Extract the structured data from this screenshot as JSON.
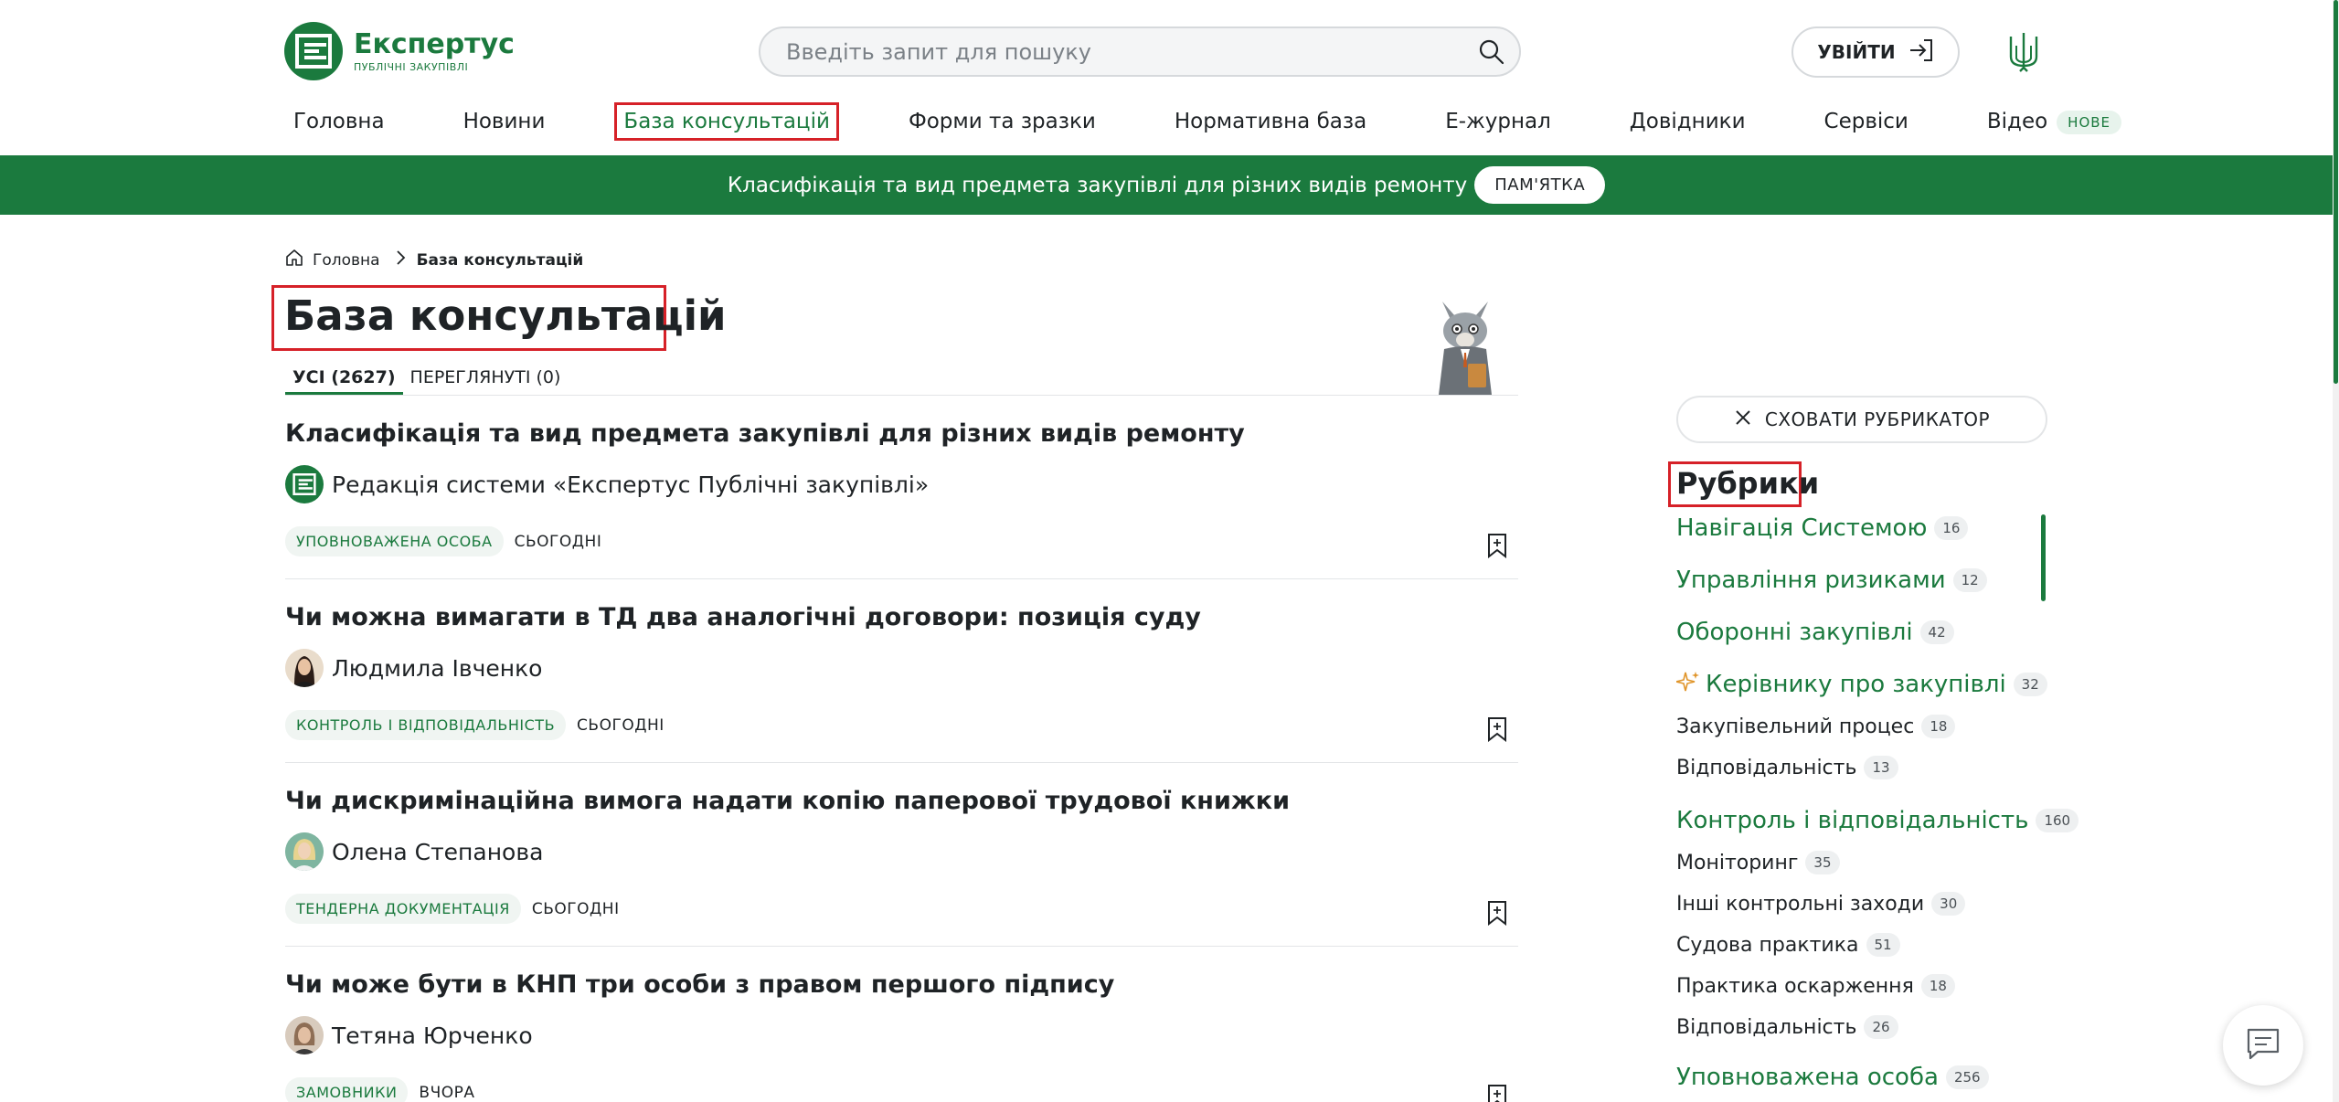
{
  "header": {
    "logo_name": "Експертус",
    "logo_sub": "ПУБЛІЧНІ ЗАКУПІВЛІ",
    "search_placeholder": "Введіть запит для пошуку",
    "login_label": "УВІЙТИ"
  },
  "nav": {
    "items": [
      {
        "label": "Головна"
      },
      {
        "label": "Новини"
      },
      {
        "label": "База консультацій"
      },
      {
        "label": "Форми та зразки"
      },
      {
        "label": "Нормативна база"
      },
      {
        "label": "Е-журнал"
      },
      {
        "label": "Довідники"
      },
      {
        "label": "Сервіси"
      },
      {
        "label": "Відео"
      }
    ],
    "active_item": "База консультацій",
    "video_badge": "НОВЕ"
  },
  "banner": {
    "text": "Класифікація та вид предмета закупівлі для різних видів ремонту",
    "button_label": "ПАМ'ЯТКА"
  },
  "breadcrumb": {
    "home": "Головна",
    "current": "База консультацій"
  },
  "page": {
    "title": "База консультацій",
    "tabs": [
      {
        "label": "УСІ (2627)",
        "active": true
      },
      {
        "label": "ПЕРЕГЛЯНУТІ (0)",
        "active": false
      }
    ]
  },
  "articles": [
    {
      "title": "Класифікація та вид предмета закупівлі для різних видів ремонту",
      "author": "Редакція системи «Експертус Публічні закупівлі»",
      "tag": "УПОВНОВАЖЕНА ОСОБА",
      "date": "СЬОГОДНІ"
    },
    {
      "title": "Чи можна вимагати в ТД два аналогічні договори: позиція суду",
      "author": "Людмила Івченко",
      "tag": "КОНТРОЛЬ І ВІДПОВІДАЛЬНІСТЬ",
      "date": "СЬОГОДНІ"
    },
    {
      "title": "Чи дискримінаційна вимога надати копію паперової трудової книжки",
      "author": "Олена Степанова",
      "tag": "ТЕНДЕРНА ДОКУМЕНТАЦІЯ",
      "date": "СЬОГОДНІ"
    },
    {
      "title": "Чи може бути в КНП три особи з правом першого підпису",
      "author": "Тетяна Юрченко",
      "tag": "ЗАМОВНИКИ",
      "date": "ВЧОРА"
    }
  ],
  "sidebar": {
    "hide_label": "СХОВАТИ РУБРИКАТОР",
    "title": "Рубрики",
    "categories": [
      {
        "label": "Навігація Системою",
        "count": "16",
        "level": "main"
      },
      {
        "label": "Управління ризиками",
        "count": "12",
        "level": "main"
      },
      {
        "label": "Оборонні закупівлі",
        "count": "42",
        "level": "main"
      },
      {
        "label": "Керівнику про закупівлі",
        "count": "32",
        "level": "main",
        "icon": "sparkle-icon"
      },
      {
        "label": "Закупівельний процес",
        "count": "18",
        "level": "sub"
      },
      {
        "label": "Відповідальність",
        "count": "13",
        "level": "sub"
      },
      {
        "label": "Контроль і відповідальність",
        "count": "160",
        "level": "main"
      },
      {
        "label": "Моніторинг",
        "count": "35",
        "level": "sub"
      },
      {
        "label": "Інші контрольні заходи",
        "count": "30",
        "level": "sub"
      },
      {
        "label": "Судова практика",
        "count": "51",
        "level": "sub"
      },
      {
        "label": "Практика оскарження",
        "count": "18",
        "level": "sub"
      },
      {
        "label": "Відповідальність",
        "count": "26",
        "level": "sub"
      },
      {
        "label": "Уповноважена особа",
        "count": "256",
        "level": "main"
      }
    ]
  },
  "colors": {
    "brand_green": "#1b7a3e",
    "highlight_red": "#d62128"
  }
}
